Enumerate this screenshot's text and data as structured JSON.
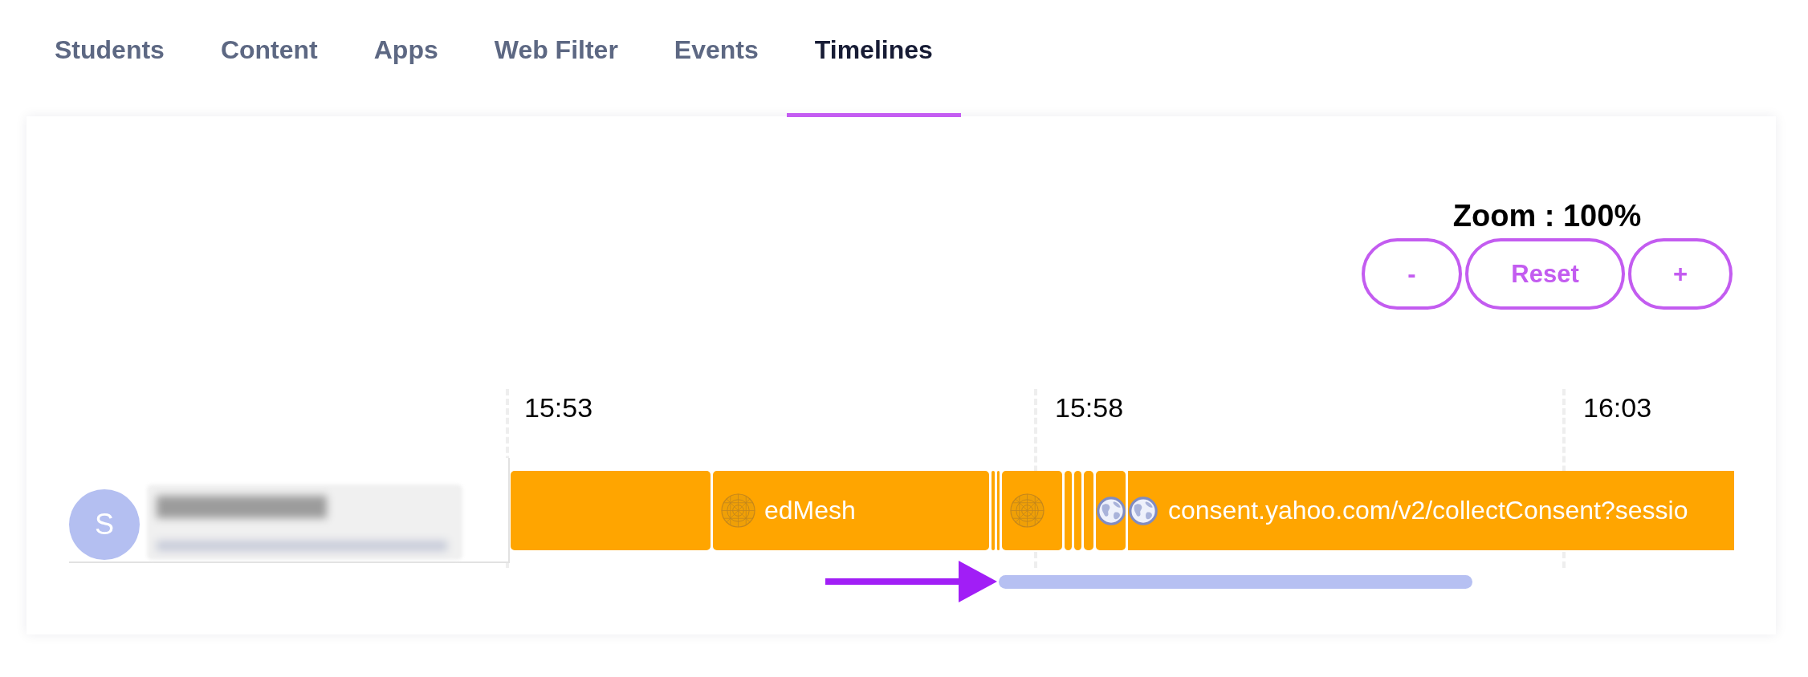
{
  "tabs": [
    {
      "label": "Students",
      "selected": false
    },
    {
      "label": "Content",
      "selected": false
    },
    {
      "label": "Apps",
      "selected": false
    },
    {
      "label": "Web Filter",
      "selected": false
    },
    {
      "label": "Events",
      "selected": false
    },
    {
      "label": "Timelines",
      "selected": true
    }
  ],
  "zoom": {
    "label": "Zoom : 100%",
    "buttons": [
      "-",
      "Reset",
      "+"
    ]
  },
  "timeline": {
    "time_labels": [
      "15:53",
      "15:58",
      "16:03"
    ],
    "rows": [
      {
        "avatar_initial": "S",
        "segments": [
          {
            "kind": "plain"
          },
          {
            "kind": "app",
            "label": "edMesh"
          },
          {
            "kind": "plain"
          },
          {
            "kind": "plain"
          },
          {
            "kind": "app"
          },
          {
            "kind": "plain"
          },
          {
            "kind": "plain"
          },
          {
            "kind": "plain"
          },
          {
            "kind": "web"
          },
          {
            "kind": "web",
            "label": "consent.yahoo.com/v2/collectConsent?sessio"
          }
        ]
      }
    ]
  }
}
